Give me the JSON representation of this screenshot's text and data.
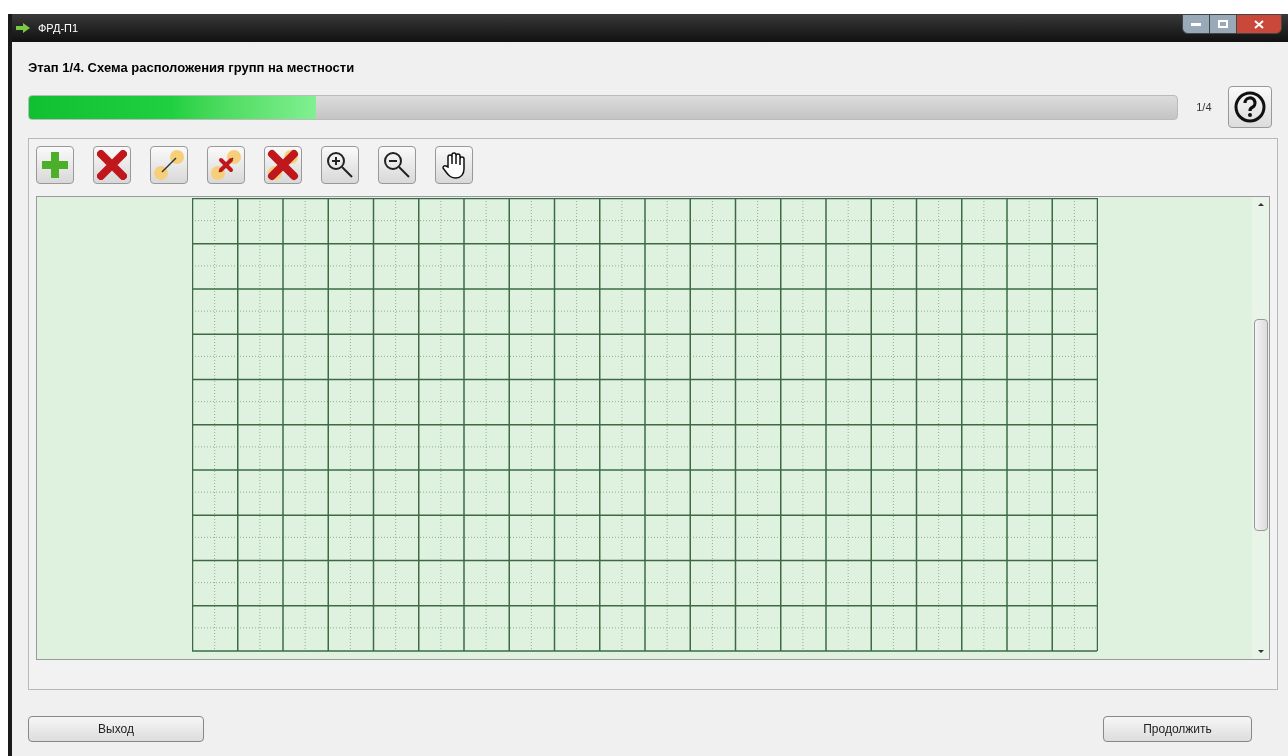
{
  "window": {
    "title": "ФРД-П1"
  },
  "heading": "Этап 1/4. Схема расположения групп на местности",
  "progress": {
    "level": 0.25,
    "reading": "1/4"
  },
  "buttons": [
    {
      "label": "Выход"
    },
    {
      "label": "Продолжить"
    }
  ]
}
